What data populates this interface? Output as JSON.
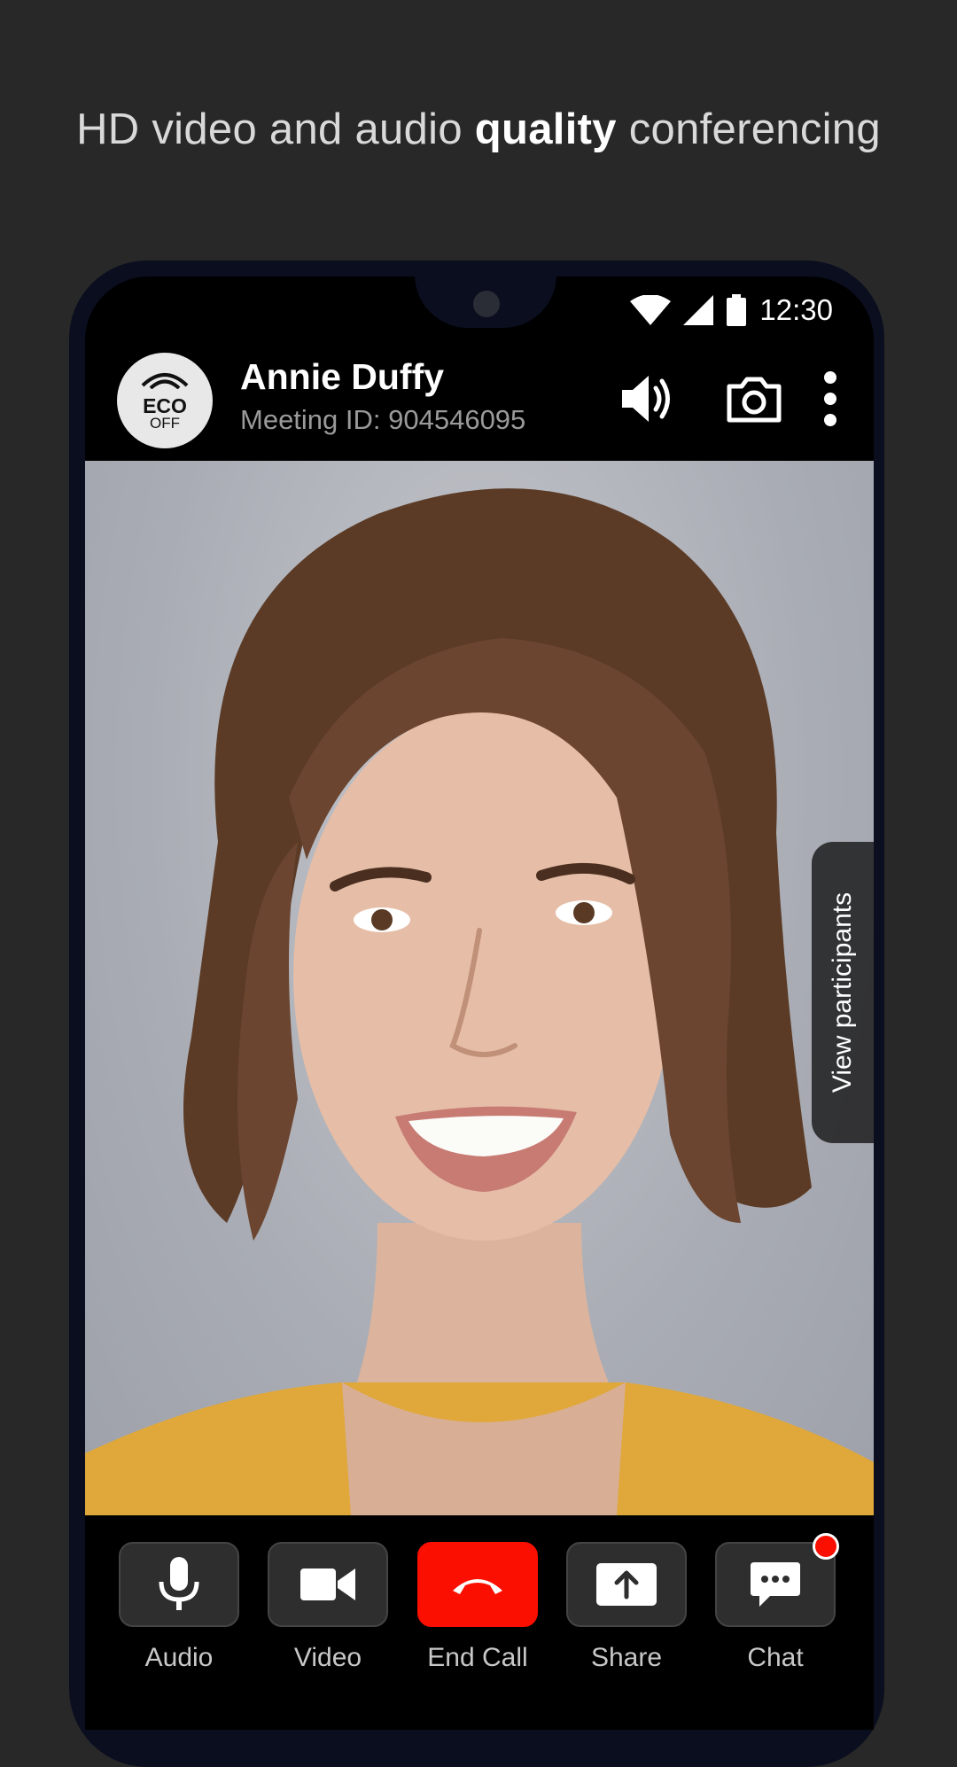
{
  "headline": {
    "pre": "HD video and audio ",
    "bold": "quality",
    "post": " conferencing"
  },
  "status_bar": {
    "time": "12:30"
  },
  "call": {
    "eco_main": "ECO",
    "eco_sub": "OFF",
    "caller_name": "Annie Duffy",
    "meeting_id": "Meeting ID: 904546095"
  },
  "participants_tab": "View participants",
  "controls": [
    {
      "label": "Audio",
      "icon": "microphone-icon"
    },
    {
      "label": "Video",
      "icon": "video-camera-icon"
    },
    {
      "label": "End Call",
      "icon": "hang-up-icon"
    },
    {
      "label": "Share",
      "icon": "share-upload-icon"
    },
    {
      "label": "Chat",
      "icon": "chat-bubble-icon"
    }
  ],
  "colors": {
    "background": "#282828",
    "end_call": "#fa0f00",
    "notification": "#fa0f00"
  }
}
